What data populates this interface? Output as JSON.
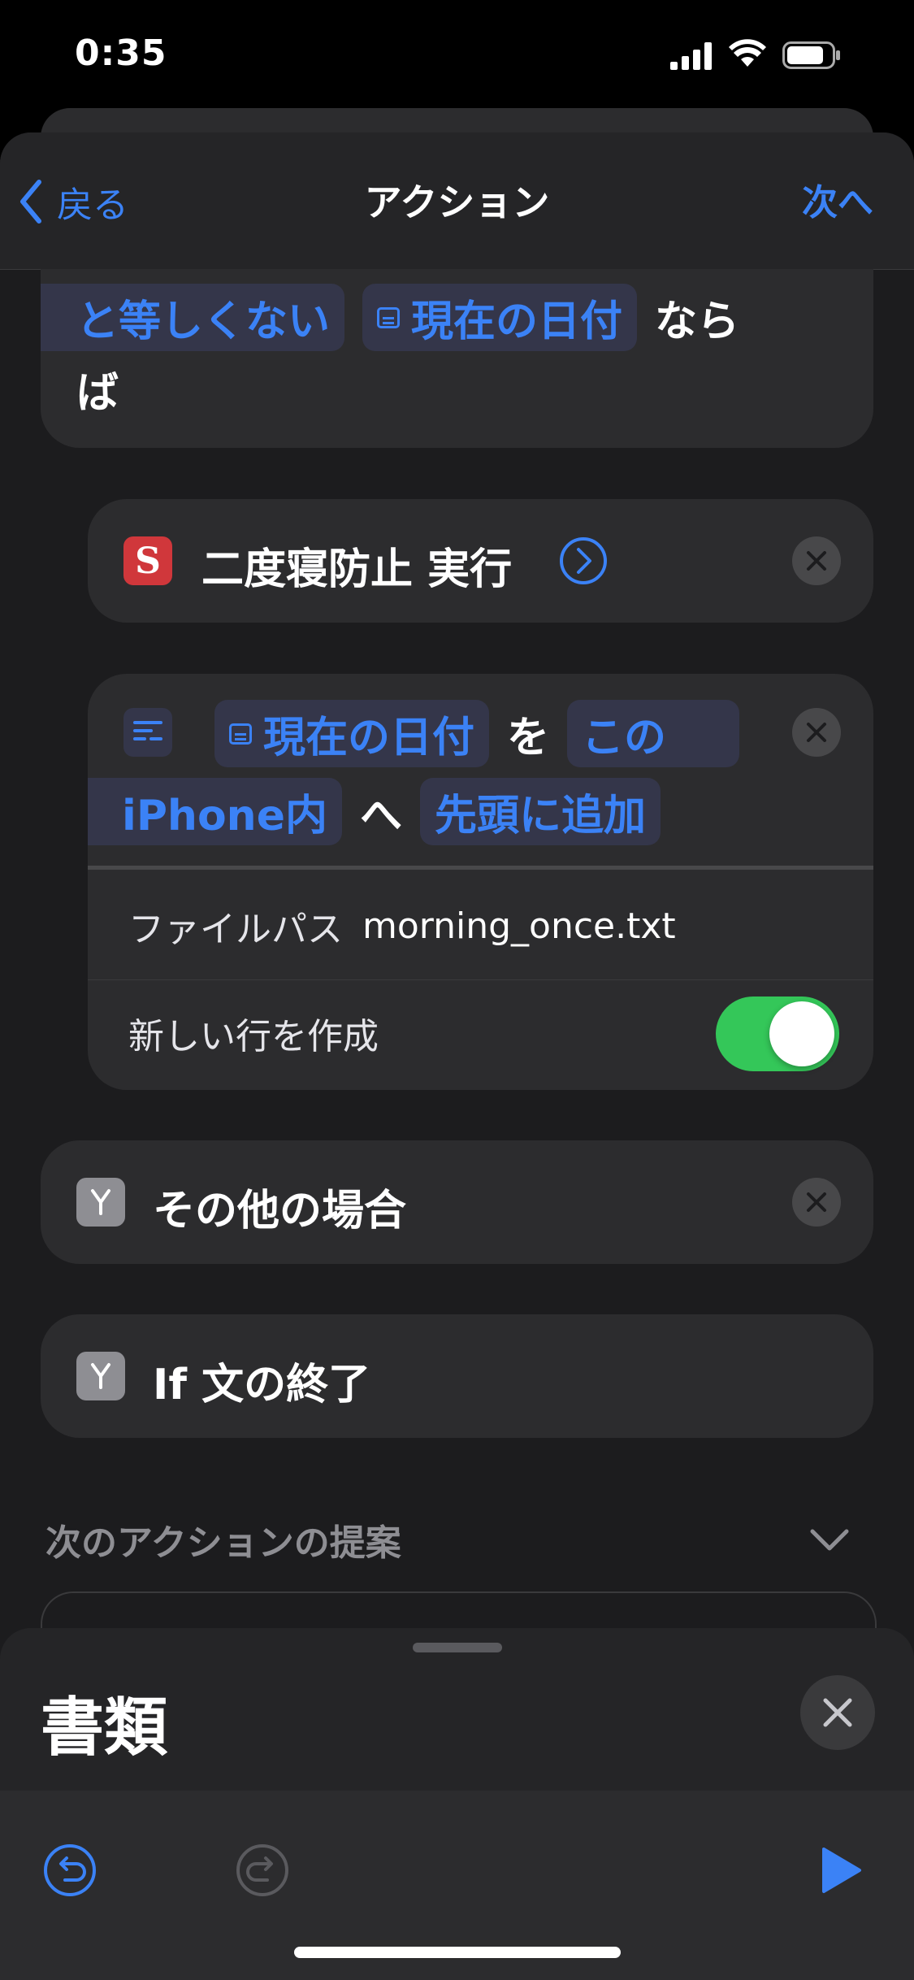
{
  "status": {
    "time": "0:35"
  },
  "nav": {
    "back": "戻る",
    "title": "アクション",
    "next": "次へ"
  },
  "if_card": {
    "condition": "と等しくない",
    "value": "現在の日付",
    "suffix1": "なら",
    "suffix2": "ば"
  },
  "run_card": {
    "app_letter": "S",
    "label": "二度寝防止 実行"
  },
  "append_card": {
    "token1": "現在の日付",
    "word1": "を",
    "token2": "この",
    "token3": "iPhone内",
    "word2": "へ",
    "token4": "先頭に追加",
    "filepath_label": "ファイルパス",
    "filepath_value": "morning_once.txt",
    "newline_label": "新しい行を作成",
    "newline_on": true
  },
  "otherwise_card": {
    "label": "その他の場合"
  },
  "endif_card": {
    "label": "If 文の終了"
  },
  "suggestions": {
    "header": "次のアクションの提案"
  },
  "bottom": {
    "title": "書類"
  },
  "colors": {
    "accent": "#3b82f6",
    "toggle_on": "#34c759",
    "app_red": "#d0373b"
  }
}
